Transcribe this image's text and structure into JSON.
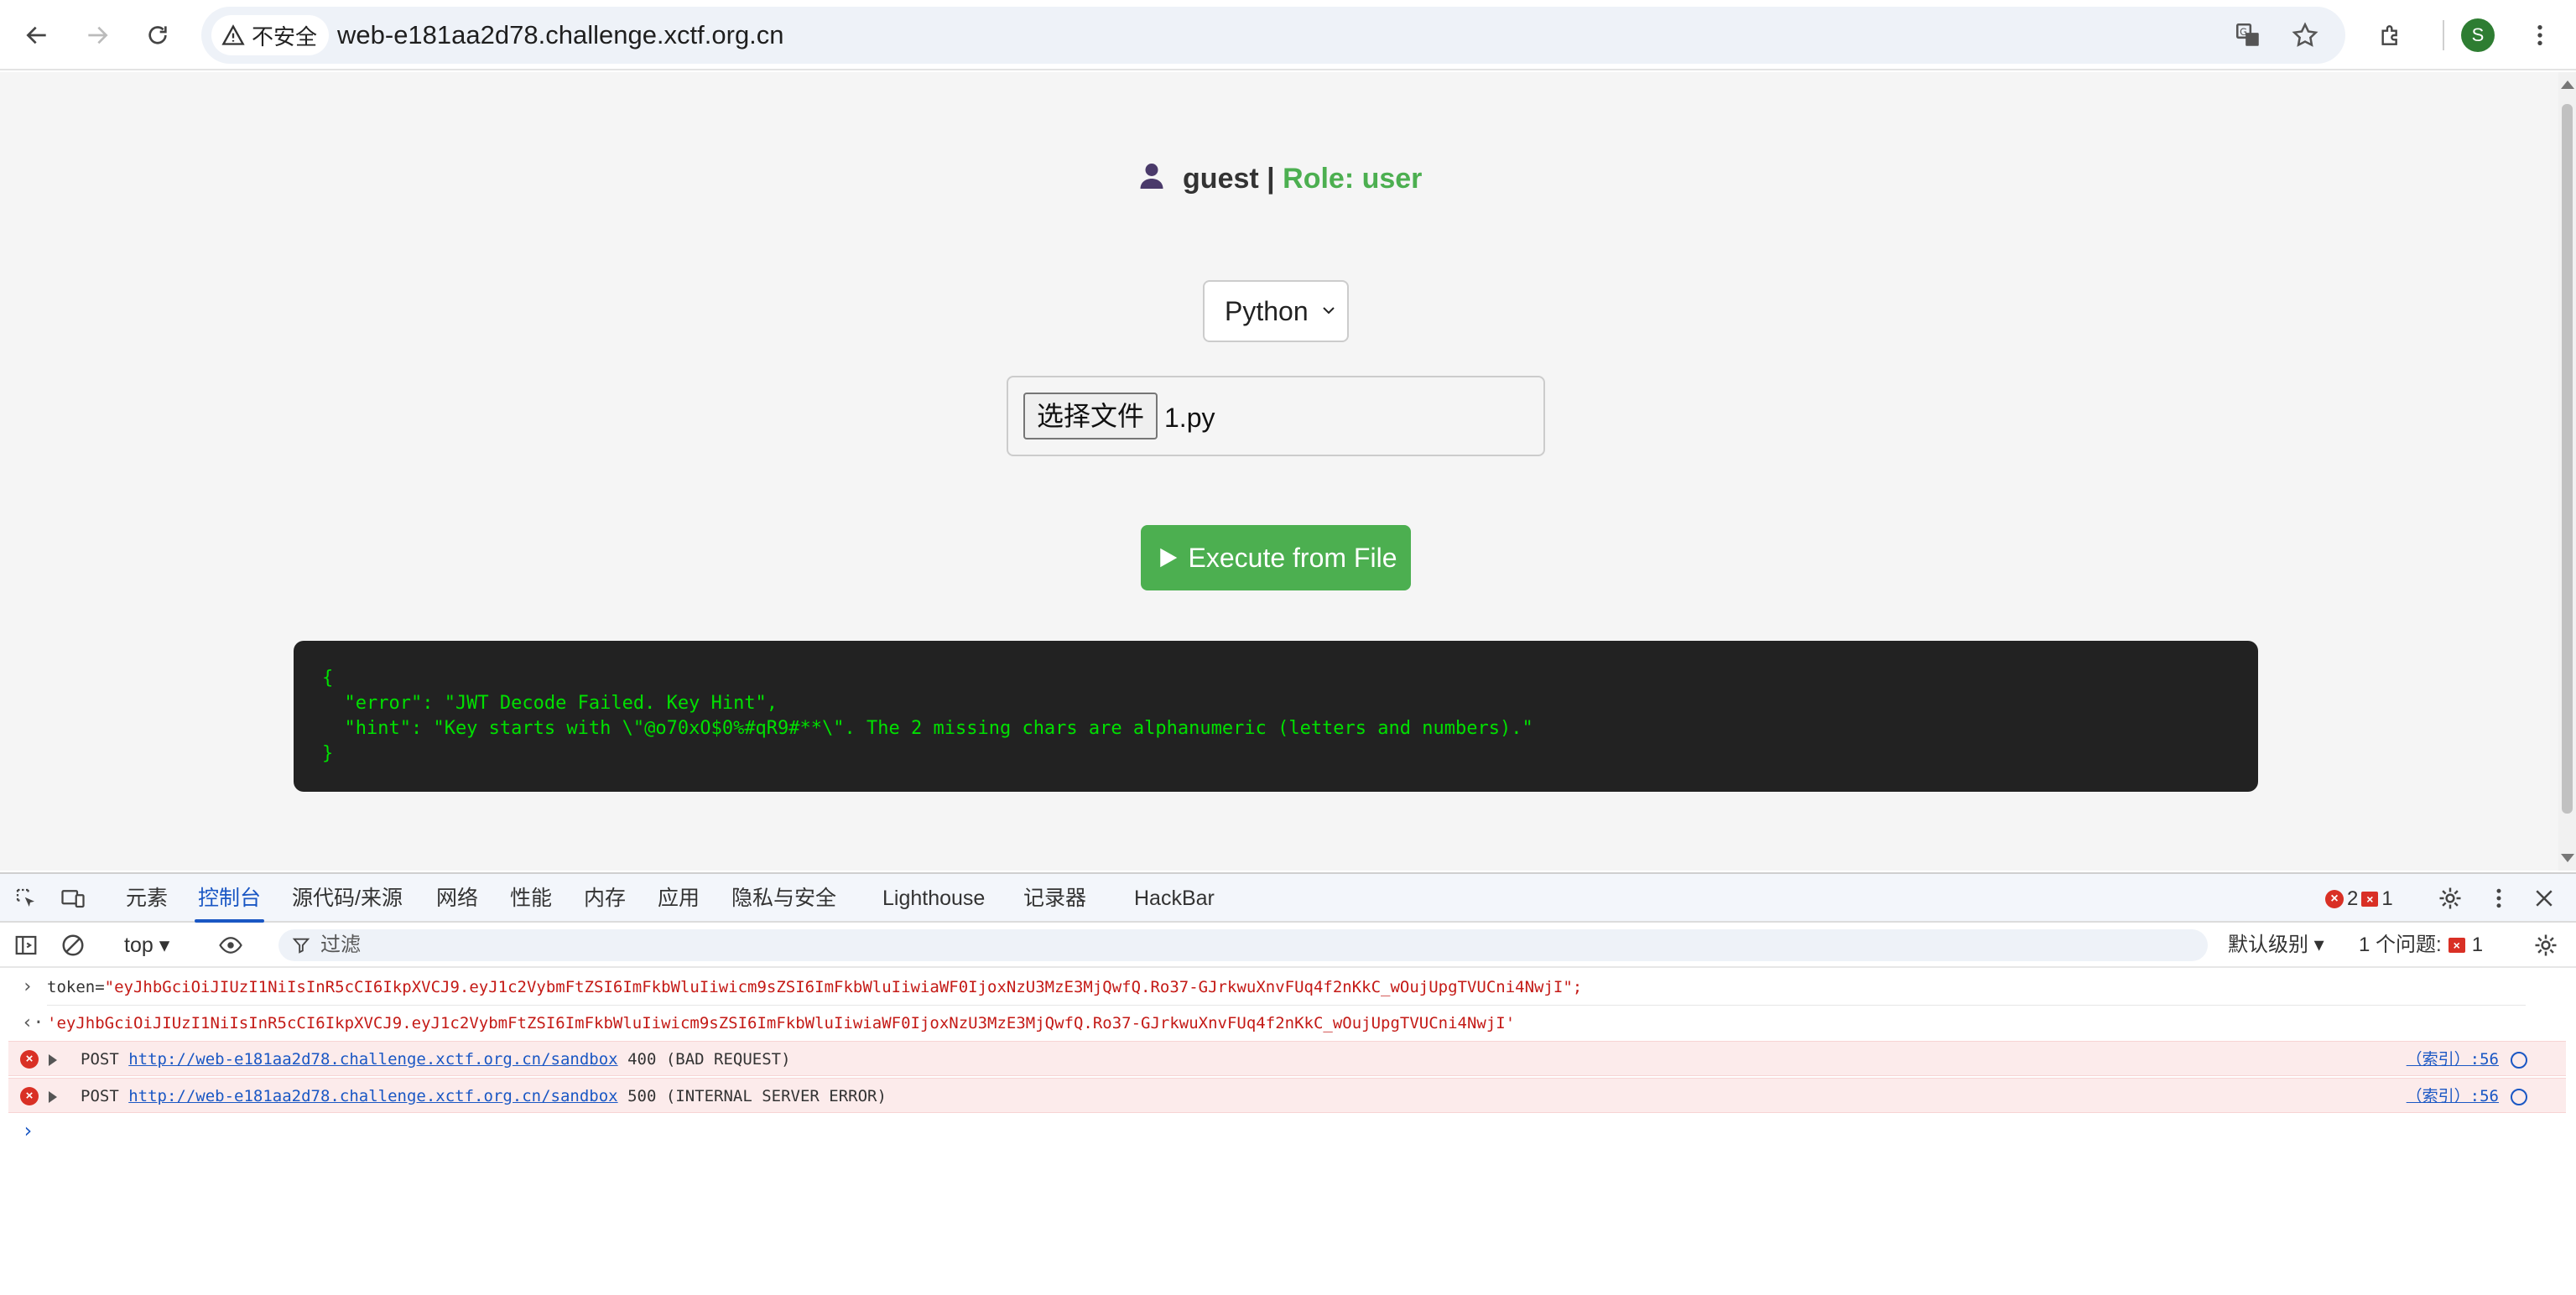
{
  "browser": {
    "security_label": "不安全",
    "url": "web-e181aa2d78.challenge.xctf.org.cn",
    "avatar_letter": "S"
  },
  "page": {
    "username": "guest",
    "separator": "|",
    "role_text": "Role: user",
    "language": "Python",
    "choose_file_label": "选择文件",
    "file_name": "1.py",
    "execute_label": "Execute from File",
    "output_text": "{\n  \"error\": \"JWT Decode Failed. Key Hint\",\n  \"hint\": \"Key starts with \\\"@o70xO$0%#qR9#**\\\". The 2 missing chars are alphanumeric (letters and numbers).\"\n}"
  },
  "devtools": {
    "tabs": [
      "元素",
      "控制台",
      "源代码/来源",
      "网络",
      "性能",
      "内存",
      "应用",
      "隐私与安全",
      "Lighthouse",
      "记录器",
      "HackBar"
    ],
    "active_tab": "控制台",
    "error_count": "2",
    "issue_count": "1",
    "context": "top",
    "filter_placeholder": "过滤",
    "level_label": "默认级别",
    "issues_label": "1 个问题:",
    "issues_badge_count": "1"
  },
  "console": {
    "input_line_prefix": "token=",
    "input_line_value": "\"eyJhbGciOiJIUzI1NiIsInR5cCI6IkpXVCJ9.eyJ1c2VybmFtZSI6ImFkbWluIiwicm9sZSI6ImFkbWluIiwiaWF0IjoxNzU3MzE3MjQwfQ.Ro37-GJrkwuXnvFUq4f2nKkC_wOujUpgTVUCni4NwjI\";",
    "result_line": "'eyJhbGciOiJIUzI1NiIsInR5cCI6IkpXVCJ9.eyJ1c2VybmFtZSI6ImFkbWluIiwicm9sZSI6ImFkbWluIiwiaWF0IjoxNzU3MzE3MjQwfQ.Ro37-GJrkwuXnvFUq4f2nKkC_wOujUpgTVUCni4NwjI'",
    "errors": [
      {
        "method": "POST",
        "url": "http://web-e181aa2d78.challenge.xctf.org.cn/sandbox",
        "status": "400 (BAD REQUEST)",
        "source": "（索引）:56"
      },
      {
        "method": "POST",
        "url": "http://web-e181aa2d78.challenge.xctf.org.cn/sandbox",
        "status": "500 (INTERNAL SERVER ERROR)",
        "source": "（索引）:56"
      }
    ]
  }
}
